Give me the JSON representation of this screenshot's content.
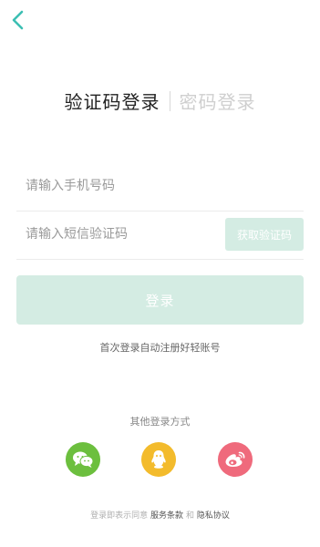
{
  "tabs": {
    "sms_login": "验证码登录",
    "password_login": "密码登录"
  },
  "form": {
    "phone_placeholder": "请输入手机号码",
    "code_placeholder": "请输入短信验证码",
    "get_code_label": "获取验证码",
    "login_label": "登录"
  },
  "hint": "首次登录自动注册好轻账号",
  "other_login": {
    "title": "其他登录方式",
    "methods": [
      "wechat",
      "qq",
      "weibo"
    ]
  },
  "agreement": {
    "prefix": "登录即表示同意",
    "terms": "服务条款",
    "and": "和",
    "privacy": "隐私协议"
  },
  "colors": {
    "accent": "#3cbfb3",
    "button_disabled": "#d4ece3",
    "wechat": "#6cbf3e",
    "qq": "#f3bb2c",
    "weibo": "#ef6a7c"
  }
}
